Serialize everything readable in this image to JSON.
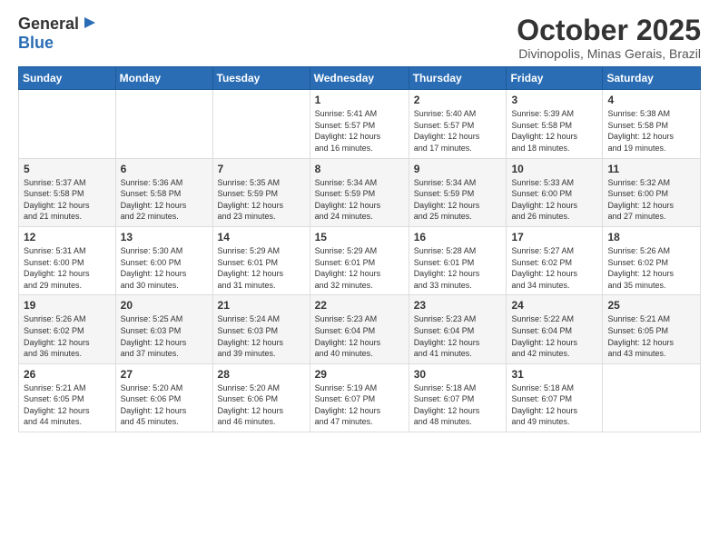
{
  "header": {
    "logo_general": "General",
    "logo_blue": "Blue",
    "title": "October 2025",
    "subtitle": "Divinopolis, Minas Gerais, Brazil"
  },
  "calendar": {
    "columns": [
      "Sunday",
      "Monday",
      "Tuesday",
      "Wednesday",
      "Thursday",
      "Friday",
      "Saturday"
    ],
    "rows": [
      [
        {
          "day": "",
          "info": ""
        },
        {
          "day": "",
          "info": ""
        },
        {
          "day": "",
          "info": ""
        },
        {
          "day": "1",
          "info": "Sunrise: 5:41 AM\nSunset: 5:57 PM\nDaylight: 12 hours\nand 16 minutes."
        },
        {
          "day": "2",
          "info": "Sunrise: 5:40 AM\nSunset: 5:57 PM\nDaylight: 12 hours\nand 17 minutes."
        },
        {
          "day": "3",
          "info": "Sunrise: 5:39 AM\nSunset: 5:58 PM\nDaylight: 12 hours\nand 18 minutes."
        },
        {
          "day": "4",
          "info": "Sunrise: 5:38 AM\nSunset: 5:58 PM\nDaylight: 12 hours\nand 19 minutes."
        }
      ],
      [
        {
          "day": "5",
          "info": "Sunrise: 5:37 AM\nSunset: 5:58 PM\nDaylight: 12 hours\nand 21 minutes."
        },
        {
          "day": "6",
          "info": "Sunrise: 5:36 AM\nSunset: 5:58 PM\nDaylight: 12 hours\nand 22 minutes."
        },
        {
          "day": "7",
          "info": "Sunrise: 5:35 AM\nSunset: 5:59 PM\nDaylight: 12 hours\nand 23 minutes."
        },
        {
          "day": "8",
          "info": "Sunrise: 5:34 AM\nSunset: 5:59 PM\nDaylight: 12 hours\nand 24 minutes."
        },
        {
          "day": "9",
          "info": "Sunrise: 5:34 AM\nSunset: 5:59 PM\nDaylight: 12 hours\nand 25 minutes."
        },
        {
          "day": "10",
          "info": "Sunrise: 5:33 AM\nSunset: 6:00 PM\nDaylight: 12 hours\nand 26 minutes."
        },
        {
          "day": "11",
          "info": "Sunrise: 5:32 AM\nSunset: 6:00 PM\nDaylight: 12 hours\nand 27 minutes."
        }
      ],
      [
        {
          "day": "12",
          "info": "Sunrise: 5:31 AM\nSunset: 6:00 PM\nDaylight: 12 hours\nand 29 minutes."
        },
        {
          "day": "13",
          "info": "Sunrise: 5:30 AM\nSunset: 6:00 PM\nDaylight: 12 hours\nand 30 minutes."
        },
        {
          "day": "14",
          "info": "Sunrise: 5:29 AM\nSunset: 6:01 PM\nDaylight: 12 hours\nand 31 minutes."
        },
        {
          "day": "15",
          "info": "Sunrise: 5:29 AM\nSunset: 6:01 PM\nDaylight: 12 hours\nand 32 minutes."
        },
        {
          "day": "16",
          "info": "Sunrise: 5:28 AM\nSunset: 6:01 PM\nDaylight: 12 hours\nand 33 minutes."
        },
        {
          "day": "17",
          "info": "Sunrise: 5:27 AM\nSunset: 6:02 PM\nDaylight: 12 hours\nand 34 minutes."
        },
        {
          "day": "18",
          "info": "Sunrise: 5:26 AM\nSunset: 6:02 PM\nDaylight: 12 hours\nand 35 minutes."
        }
      ],
      [
        {
          "day": "19",
          "info": "Sunrise: 5:26 AM\nSunset: 6:02 PM\nDaylight: 12 hours\nand 36 minutes."
        },
        {
          "day": "20",
          "info": "Sunrise: 5:25 AM\nSunset: 6:03 PM\nDaylight: 12 hours\nand 37 minutes."
        },
        {
          "day": "21",
          "info": "Sunrise: 5:24 AM\nSunset: 6:03 PM\nDaylight: 12 hours\nand 39 minutes."
        },
        {
          "day": "22",
          "info": "Sunrise: 5:23 AM\nSunset: 6:04 PM\nDaylight: 12 hours\nand 40 minutes."
        },
        {
          "day": "23",
          "info": "Sunrise: 5:23 AM\nSunset: 6:04 PM\nDaylight: 12 hours\nand 41 minutes."
        },
        {
          "day": "24",
          "info": "Sunrise: 5:22 AM\nSunset: 6:04 PM\nDaylight: 12 hours\nand 42 minutes."
        },
        {
          "day": "25",
          "info": "Sunrise: 5:21 AM\nSunset: 6:05 PM\nDaylight: 12 hours\nand 43 minutes."
        }
      ],
      [
        {
          "day": "26",
          "info": "Sunrise: 5:21 AM\nSunset: 6:05 PM\nDaylight: 12 hours\nand 44 minutes."
        },
        {
          "day": "27",
          "info": "Sunrise: 5:20 AM\nSunset: 6:06 PM\nDaylight: 12 hours\nand 45 minutes."
        },
        {
          "day": "28",
          "info": "Sunrise: 5:20 AM\nSunset: 6:06 PM\nDaylight: 12 hours\nand 46 minutes."
        },
        {
          "day": "29",
          "info": "Sunrise: 5:19 AM\nSunset: 6:07 PM\nDaylight: 12 hours\nand 47 minutes."
        },
        {
          "day": "30",
          "info": "Sunrise: 5:18 AM\nSunset: 6:07 PM\nDaylight: 12 hours\nand 48 minutes."
        },
        {
          "day": "31",
          "info": "Sunrise: 5:18 AM\nSunset: 6:07 PM\nDaylight: 12 hours\nand 49 minutes."
        },
        {
          "day": "",
          "info": ""
        }
      ]
    ]
  }
}
